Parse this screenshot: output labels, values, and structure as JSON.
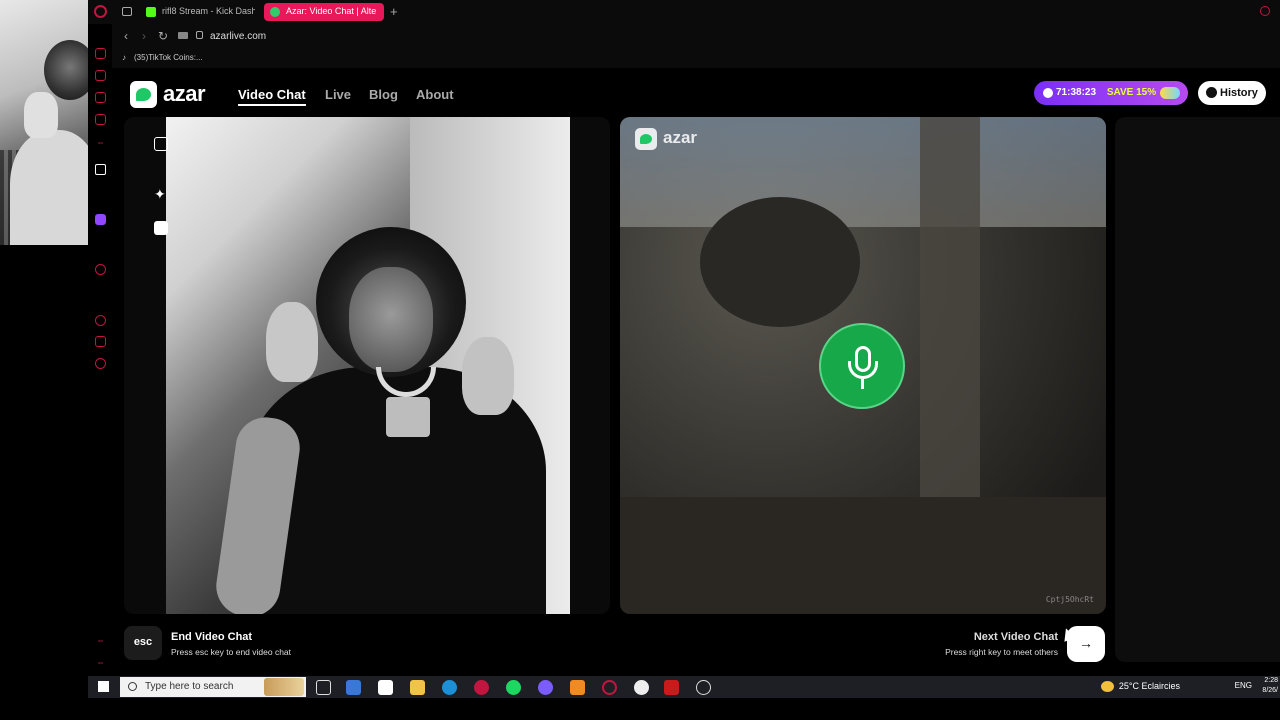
{
  "browser": {
    "tabs": [
      {
        "title": "rifl8 Stream - Kick Dashb"
      },
      {
        "title": "Azar: Video Chat | Alte"
      }
    ],
    "new_tab": "+",
    "url": "azarlive.com",
    "bookmark": "(35)TikTok Coins:..."
  },
  "site": {
    "logo": "azar",
    "nav": [
      {
        "label": "Video Chat",
        "active": true
      },
      {
        "label": "Live"
      },
      {
        "label": "Blog"
      },
      {
        "label": "About"
      }
    ],
    "promo": {
      "timer": "71:38:23",
      "save": "SAVE 15%"
    },
    "history": "History"
  },
  "chat": {
    "peer_watermark": "azar",
    "peer_id": "Cptj5OhcRt",
    "end": {
      "key": "esc",
      "title": "End Video Chat",
      "subtitle": "Press esc key to end video chat"
    },
    "next": {
      "title": "Next Video Chat",
      "subtitle": "Press right key to meet others",
      "arrow": "→"
    }
  },
  "taskbar": {
    "search_placeholder": "Type here to search",
    "weather": "25°C Eclaircies",
    "lang": "ENG",
    "time": "2:28",
    "date": "8/26/"
  },
  "colors": {
    "accent_green": "#17a84a",
    "opera_red": "#c0163f",
    "promo_purple": "#7b2ff7"
  }
}
